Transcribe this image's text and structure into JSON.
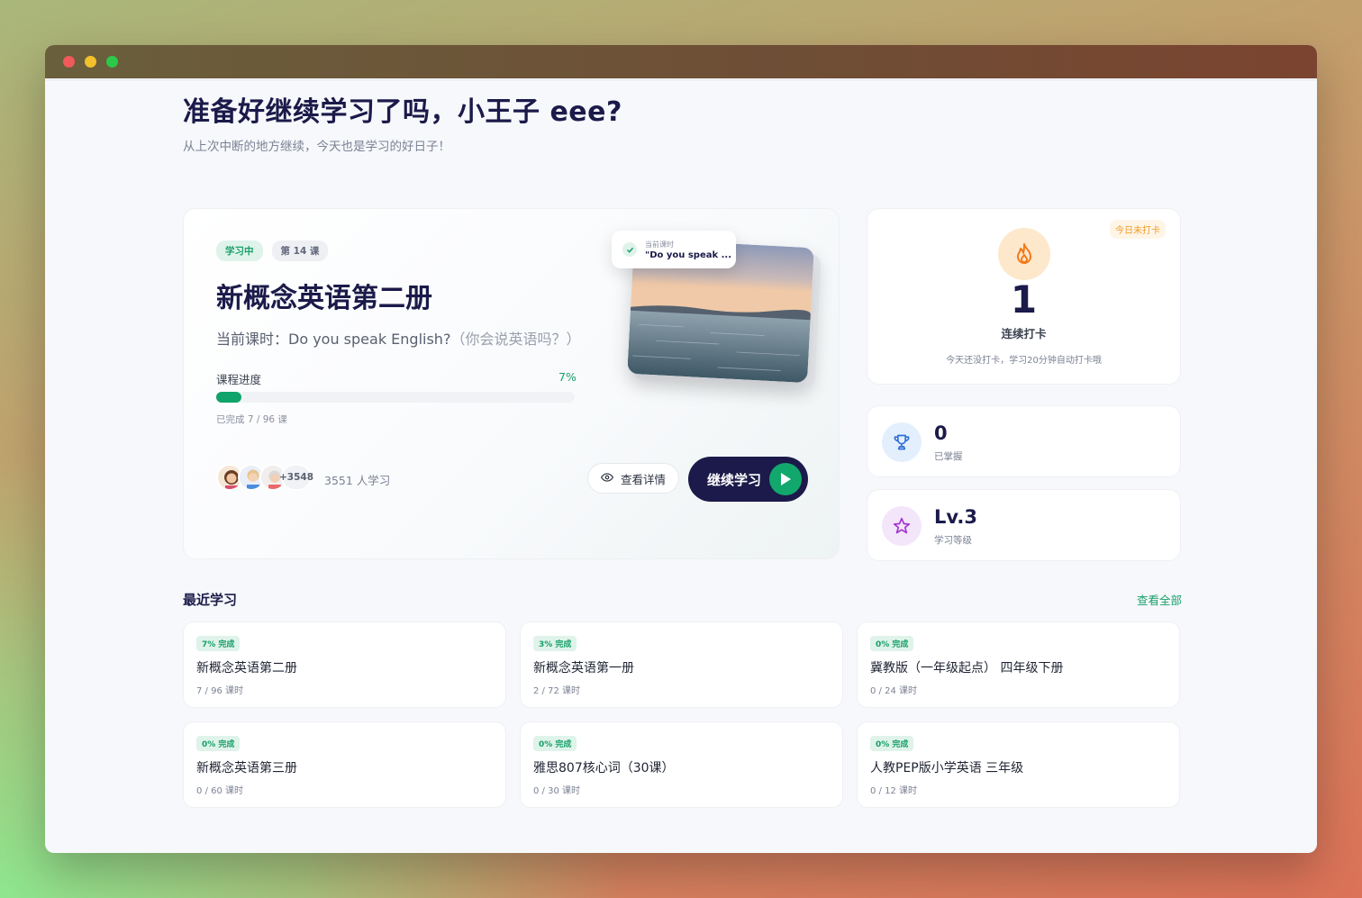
{
  "greeting": "准备好继续学习了吗，小王子 eee?",
  "subtitle": "从上次中断的地方继续，今天也是学习的好日子！",
  "hero": {
    "status_badge": "学习中",
    "lesson_badge": "第 14 课",
    "title": "新概念英语第二册",
    "lesson_prefix": "当前课时：Do you speak English?",
    "lesson_cn": "（你会说英语吗？）",
    "progress_label": "课程进度",
    "progress_pct_text": "7%",
    "progress_value": 7,
    "progress_sub": "已完成 7 / 96 课",
    "avatar_more": "+3548",
    "learners": "3551 人学习",
    "detail_button": "查看详情",
    "continue_button": "继续学习",
    "popup_small": "当前课时",
    "popup_text": "\"Do you speak ..."
  },
  "streak": {
    "tag": "今日未打卡",
    "count": "1",
    "label": "连续打卡",
    "note": "今天还没打卡，学习20分钟自动打卡哦"
  },
  "stats": [
    {
      "value": "0",
      "label": "已掌握",
      "icon": "trophy-icon"
    },
    {
      "value": "Lv.3",
      "label": "学习等级",
      "icon": "star-icon"
    }
  ],
  "recent": {
    "title": "最近学习",
    "view_all": "查看全部",
    "courses": [
      {
        "badge": "7% 完成",
        "title": "新概念英语第二册",
        "sub": "7 / 96 课时"
      },
      {
        "badge": "3% 完成",
        "title": "新概念英语第一册",
        "sub": "2 / 72 课时"
      },
      {
        "badge": "0% 完成",
        "title": "冀教版（一年级起点） 四年级下册",
        "sub": "0 / 24 课时"
      },
      {
        "badge": "0% 完成",
        "title": "新概念英语第三册",
        "sub": "0 / 60 课时"
      },
      {
        "badge": "0% 完成",
        "title": "雅思807核心词（30课）",
        "sub": "0 / 30 课时"
      },
      {
        "badge": "0% 完成",
        "title": "人教PEP版小学英语 三年级",
        "sub": "0 / 12 课时"
      }
    ]
  },
  "colors": {
    "accent": "#10a36b",
    "navy": "#1b1a4a",
    "flame": "#f07a1a"
  }
}
